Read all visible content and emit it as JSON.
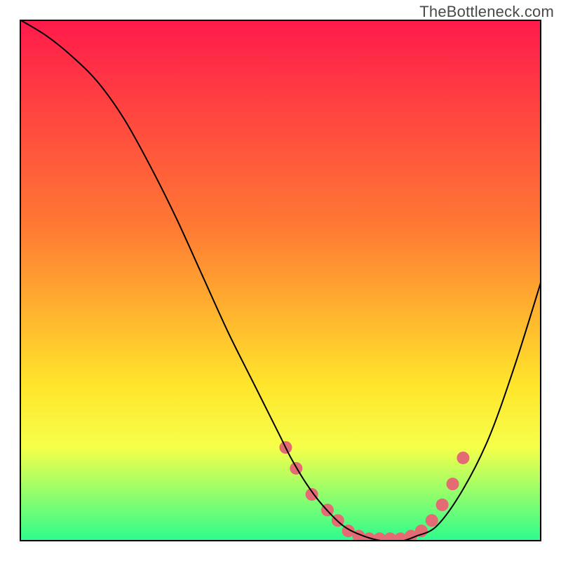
{
  "watermark": "TheBottleneck.com",
  "colors": {
    "gradient_top": "#ff1a4b",
    "gradient_mid1": "#ff7a33",
    "gradient_mid2": "#ffe52b",
    "gradient_mid3": "#f6ff4a",
    "gradient_bottom": "#2cfc8e",
    "frame": "#000000",
    "curve": "#000000",
    "dot": "#e46a74"
  },
  "chart_data": {
    "type": "line",
    "title": "",
    "xlabel": "",
    "ylabel": "",
    "xlim": [
      0,
      100
    ],
    "ylim": [
      0,
      100
    ],
    "series": [
      {
        "name": "bottleneck-curve",
        "x": [
          0,
          5,
          10,
          15,
          20,
          25,
          30,
          35,
          40,
          45,
          50,
          52,
          55,
          58,
          62,
          66,
          70,
          73,
          76,
          80,
          85,
          90,
          95,
          100
        ],
        "y": [
          100,
          97,
          93,
          88,
          81,
          72,
          62,
          51,
          40,
          30,
          20,
          16,
          11,
          7,
          3,
          1,
          0,
          0,
          1,
          3,
          10,
          20,
          34,
          50
        ]
      }
    ],
    "dots": {
      "name": "highlight-dots",
      "x": [
        51,
        53,
        56,
        59,
        61,
        63,
        65,
        67,
        69,
        71,
        73,
        75,
        77,
        79,
        81,
        83,
        85
      ],
      "y": [
        18,
        14,
        9,
        6,
        4,
        2,
        1,
        0.5,
        0.5,
        0.5,
        0.5,
        1,
        2,
        4,
        7,
        11,
        16
      ]
    },
    "gradient_stops": [
      {
        "offset": 0,
        "value": 100
      },
      {
        "offset": 40,
        "value": 60
      },
      {
        "offset": 70,
        "value": 30
      },
      {
        "offset": 82,
        "value": 18
      },
      {
        "offset": 100,
        "value": 0
      }
    ]
  }
}
